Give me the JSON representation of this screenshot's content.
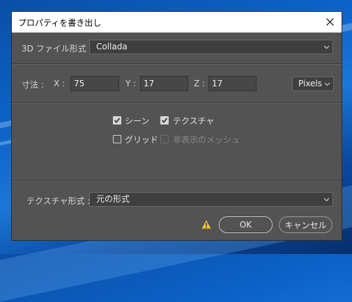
{
  "window": {
    "title": "プロパティを書き出し"
  },
  "file_format": {
    "label": "3D ファイル形式 :",
    "value": "Collada"
  },
  "dimensions": {
    "label": "寸法 :",
    "x_label": "X :",
    "x_value": "75",
    "y_label": "Y :",
    "y_value": "17",
    "z_label": "Z :",
    "z_value": "17",
    "unit": "Pixels"
  },
  "options": {
    "scene": {
      "label": "シーン",
      "checked": true
    },
    "texture": {
      "label": "テクスチャ",
      "checked": true
    },
    "grid": {
      "label": "グリッド",
      "checked": false
    },
    "hidden_mesh": {
      "label": "非表示のメッシュ",
      "checked": false,
      "enabled": false
    }
  },
  "texture_format": {
    "label": "テクスチャ形式 :",
    "value": "元の形式"
  },
  "buttons": {
    "ok": "OK",
    "cancel": "キャンセル"
  },
  "colors": {
    "dialog_bg": "#535353",
    "desktop_bg": "#0d63c9",
    "warning": "#f2c037"
  }
}
